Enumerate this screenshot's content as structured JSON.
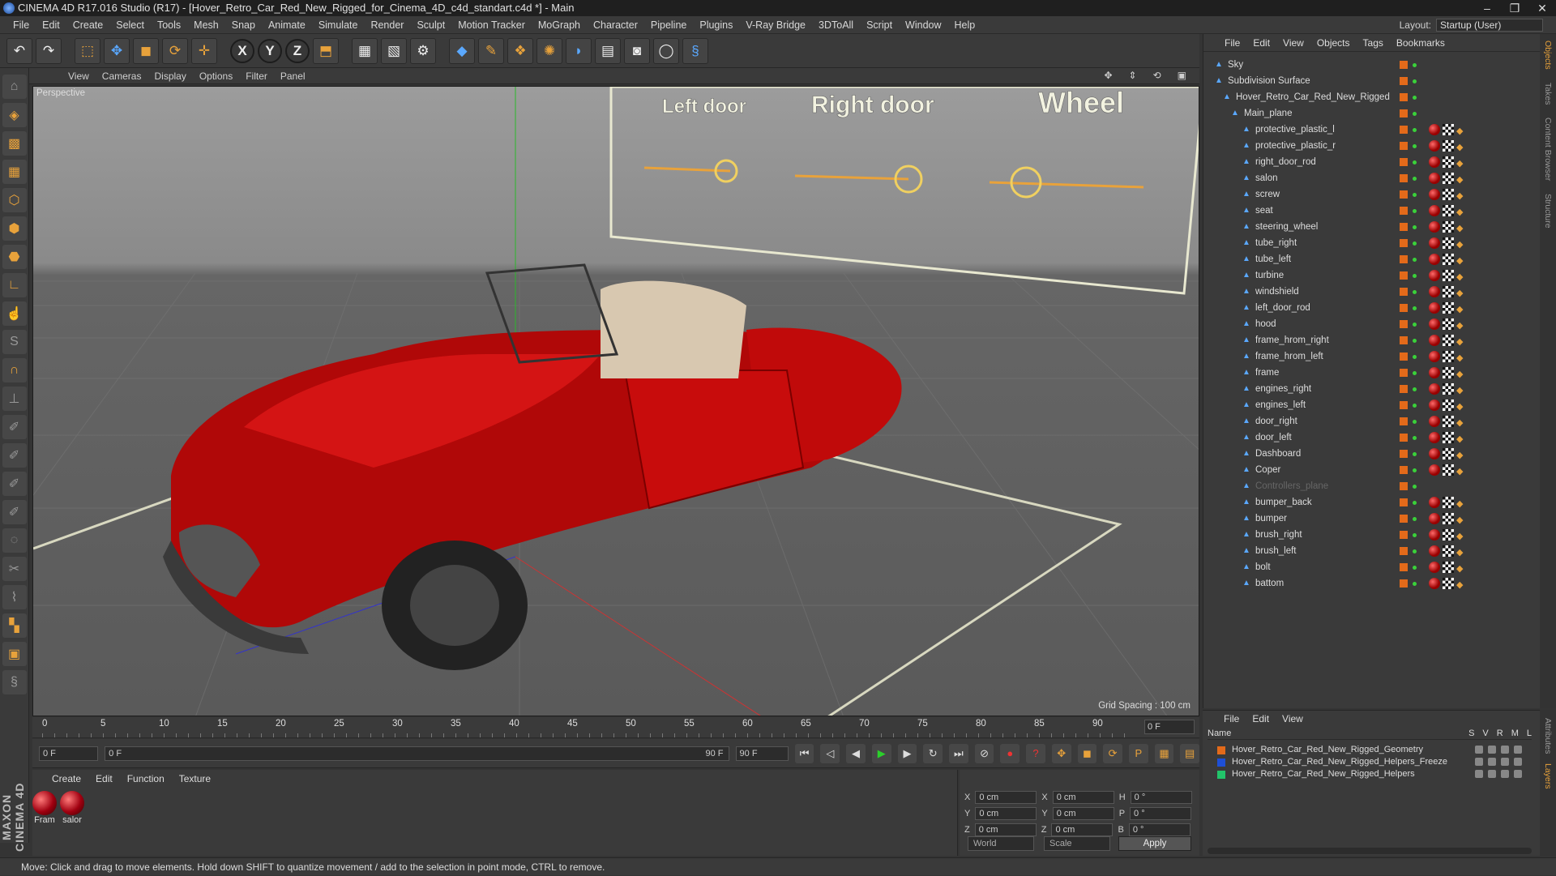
{
  "window": {
    "title": "CINEMA 4D R17.016 Studio (R17) - [Hover_Retro_Car_Red_New_Rigged_for_Cinema_4D_c4d_standart.c4d *] - Main",
    "controls": [
      "–",
      "❐",
      "✕"
    ]
  },
  "menu": [
    "File",
    "Edit",
    "Create",
    "Select",
    "Tools",
    "Mesh",
    "Snap",
    "Animate",
    "Simulate",
    "Render",
    "Sculpt",
    "Motion Tracker",
    "MoGraph",
    "Character",
    "Pipeline",
    "Plugins",
    "V-Ray Bridge",
    "3DToAll",
    "Script",
    "Window",
    "Help"
  ],
  "layout": {
    "label": "Layout:",
    "value": "Startup (User)"
  },
  "viewport": {
    "menu": [
      "View",
      "Cameras",
      "Display",
      "Options",
      "Filter",
      "Panel"
    ],
    "label": "Perspective",
    "grid_spacing": "Grid Spacing : 100 cm",
    "overlay_labels": [
      "Left door",
      "Right door",
      "Wheel"
    ]
  },
  "timeline": {
    "ticks": [
      "0",
      "5",
      "10",
      "15",
      "20",
      "25",
      "30",
      "35",
      "40",
      "45",
      "50",
      "55",
      "60",
      "65",
      "70",
      "75",
      "80",
      "85",
      "90"
    ],
    "current_frame": "0 F"
  },
  "transport": {
    "start": "0 F",
    "range_start": "0 F",
    "range_end": "90 F",
    "end": "90 F"
  },
  "materials": {
    "menu": [
      "Create",
      "Edit",
      "Function",
      "Texture"
    ],
    "items": [
      {
        "label": "Fram"
      },
      {
        "label": "salor"
      }
    ]
  },
  "coords": {
    "rows": [
      {
        "a": "X",
        "av": "0 cm",
        "b": "X",
        "bv": "0 cm",
        "c": "H",
        "cv": "0 °"
      },
      {
        "a": "Y",
        "av": "0 cm",
        "b": "Y",
        "bv": "0 cm",
        "c": "P",
        "cv": "0 °"
      },
      {
        "a": "Z",
        "av": "0 cm",
        "b": "Z",
        "bv": "0 cm",
        "c": "B",
        "cv": "0 °"
      }
    ],
    "mode": "World",
    "scale": "Scale",
    "apply": "Apply"
  },
  "status": "Move: Click and drag to move elements. Hold down SHIFT to quantize movement / add to the selection in point mode, CTRL to remove.",
  "brand": "MAXON CINEMA 4D",
  "objects": {
    "menu": [
      "File",
      "Edit",
      "View",
      "Objects",
      "Tags",
      "Bookmarks"
    ],
    "items": [
      {
        "name": "Sky",
        "level": 0
      },
      {
        "name": "Subdivision Surface",
        "level": 0
      },
      {
        "name": "Hover_Retro_Car_Red_New_Rigged",
        "level": 1
      },
      {
        "name": "Main_plane",
        "level": 2
      },
      {
        "name": "protective_plastic_l",
        "level": 3
      },
      {
        "name": "protective_plastic_r",
        "level": 3
      },
      {
        "name": "right_door_rod",
        "level": 3
      },
      {
        "name": "salon",
        "level": 3
      },
      {
        "name": "screw",
        "level": 3
      },
      {
        "name": "seat",
        "level": 3
      },
      {
        "name": "steering_wheel",
        "level": 3
      },
      {
        "name": "tube_right",
        "level": 3
      },
      {
        "name": "tube_left",
        "level": 3
      },
      {
        "name": "turbine",
        "level": 3
      },
      {
        "name": "windshield",
        "level": 3
      },
      {
        "name": "left_door_rod",
        "level": 3
      },
      {
        "name": "hood",
        "level": 3
      },
      {
        "name": "frame_hrom_right",
        "level": 3
      },
      {
        "name": "frame_hrom_left",
        "level": 3
      },
      {
        "name": "frame",
        "level": 3
      },
      {
        "name": "engines_right",
        "level": 3
      },
      {
        "name": "engines_left",
        "level": 3
      },
      {
        "name": "door_right",
        "level": 3
      },
      {
        "name": "door_left",
        "level": 3
      },
      {
        "name": "Dashboard",
        "level": 3
      },
      {
        "name": "Coper",
        "level": 3
      },
      {
        "name": "Controllers_plane",
        "level": 3
      },
      {
        "name": "bumper_back",
        "level": 3
      },
      {
        "name": "bumper",
        "level": 3
      },
      {
        "name": "brush_right",
        "level": 3
      },
      {
        "name": "brush_left",
        "level": 3
      },
      {
        "name": "bolt",
        "level": 3
      },
      {
        "name": "battom",
        "level": 3
      }
    ]
  },
  "side_tabs": [
    "Objects",
    "Takes",
    "Content Browser",
    "Structure"
  ],
  "side_tabs2": [
    "Attributes",
    "Layers"
  ],
  "layers": {
    "menu": [
      "File",
      "Edit",
      "View"
    ],
    "header": {
      "name": "Name",
      "cols": [
        "S",
        "V",
        "R",
        "M",
        "L"
      ]
    },
    "items": [
      {
        "name": "Hover_Retro_Car_Red_New_Rigged_Geometry",
        "color": "#e36a1a"
      },
      {
        "name": "Hover_Retro_Car_Red_New_Rigged_Helpers_Freeze",
        "color": "#1e4fd6"
      },
      {
        "name": "Hover_Retro_Car_Red_New_Rigged_Helpers",
        "color": "#22c46a"
      }
    ]
  },
  "colors": {
    "accent": "#e8a23b",
    "car_red": "#c40a0a",
    "panel": "#3a3a3a"
  }
}
